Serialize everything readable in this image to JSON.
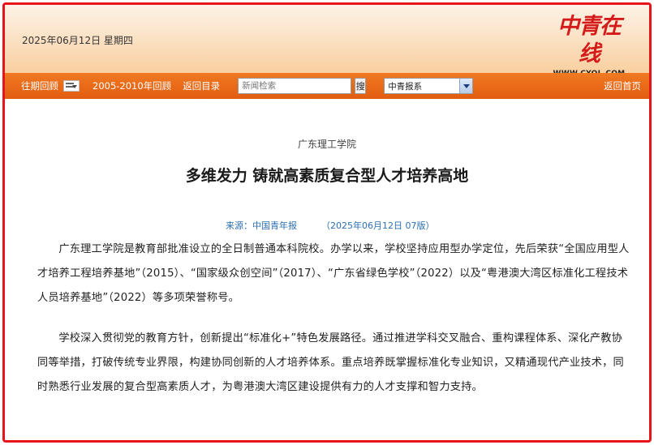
{
  "header": {
    "date": "2025年06月12日 星期四",
    "logo_text": "中青在线",
    "logo_url": "WWW.CYOL.COM"
  },
  "navbar": {
    "back_issues": "往期回顾",
    "archive_2005": "2005-2010年回顾",
    "back_directory": "返回目录",
    "search_placeholder": "新闻检索",
    "search_button": "搜",
    "select_value": "中青报系",
    "back_home": "返回首页"
  },
  "article": {
    "school": "广东理工学院",
    "headline": "多维发力 铸就高素质复合型人才培养高地",
    "source": "来源：中国青年报",
    "date_edition": "（2025年06月12日  07版）",
    "paragraphs": [
      "广东理工学院是教育部批准设立的全日制普通本科院校。办学以来，学校坚持应用型办学定位，先后荣获“全国应用型人才培养工程培养基地”（2015）、“国家级众创空间”（2017）、“广东省绿色学校”（2022）以及“粤港澳大湾区标准化工程技术人员培养基地”（2022）等多项荣誉称号。",
      "学校深入贯彻党的教育方针，创新提出“标准化+”特色发展路径。通过推进学科交叉融合、重构课程体系、深化产教协同等举措，打破传统专业界限，构建协同创新的人才培养体系。重点培养既掌握标准化专业知识，又精通现代产业技术，同时熟悉行业发展的复合型高素质人才，为粤港澳大湾区建设提供有力的人才支撑和智力支持。"
    ]
  },
  "colors": {
    "frame_border": "#e8141c",
    "nav_orange": "#e86a18",
    "logo_red": "#d51a1a",
    "meta_blue": "#2b6fb3"
  }
}
